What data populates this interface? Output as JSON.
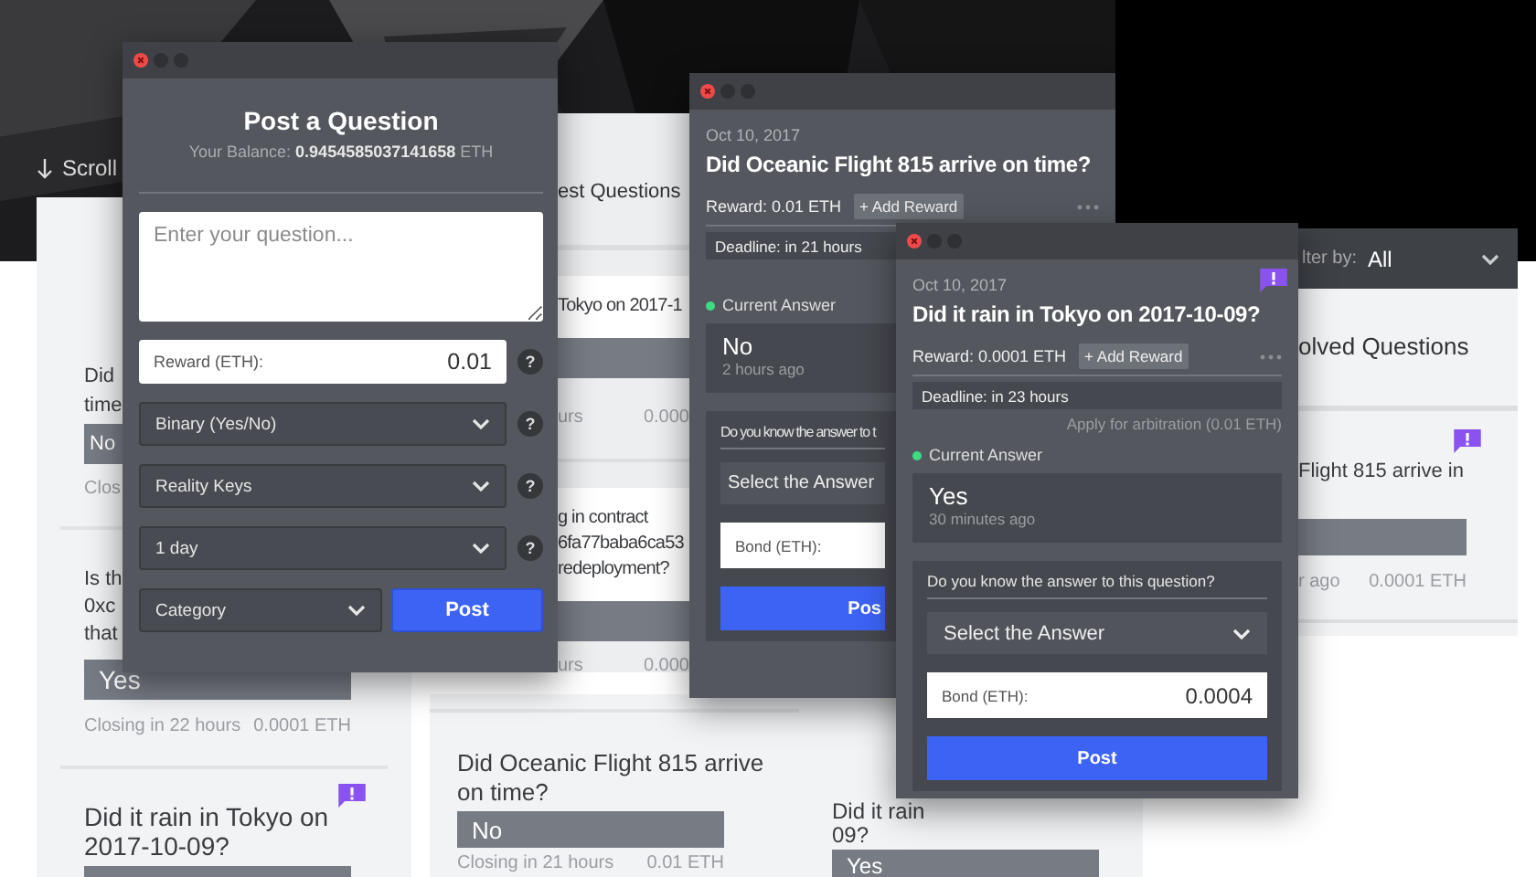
{
  "scroll_hint": "Scroll",
  "left_column": {
    "cards": [
      {
        "question": "Did time",
        "answer": "No",
        "closing": "Clos",
        "flagged": false
      },
      {
        "question": "Is th 0xc that",
        "answer": "Yes",
        "closing": "Closing in 22 hours",
        "reward": "0.0001 ETH",
        "flagged": false
      },
      {
        "question": "Did it rain in Tokyo on 2017-10-09?",
        "flagged": true
      }
    ]
  },
  "middle_column": {
    "heading": "est Questions",
    "cards": [
      {
        "question": "Tokyo on 2017-1",
        "closing": "urs",
        "reward": "0.000",
        "flagged": false
      },
      {
        "question": "g in contract 6fa77baba6ca53 redeployment?",
        "closing": "urs",
        "reward": "0.000",
        "flagged": false
      },
      {
        "question": "Did Oceanic Flight 815 arrive on time?",
        "answer": "No",
        "closing": "Closing in 21 hours",
        "reward": "0.01 ETH",
        "flagged": false
      }
    ]
  },
  "third_column": {
    "cards": [
      {
        "question": "Did it rain 09?",
        "answer": "Yes",
        "flagged": false
      }
    ]
  },
  "right_column": {
    "filter_label": "lter by:",
    "filter_value": "All",
    "heading": "olved Questions",
    "cards": [
      {
        "question": "Flight 815 arrive in",
        "closing": "r ago",
        "reward": "0.0001 ETH",
        "flagged": true
      }
    ]
  },
  "post_window": {
    "title": "Post a Question",
    "balance": "Your Balance: **0.9454585037141658** ETH",
    "question_placeholder": "Enter your question...",
    "reward_label": "Reward (ETH):",
    "reward_value": "0.01",
    "reward_help": "?",
    "selects": [
      {
        "value": "Binary (Yes/No)",
        "help": "?"
      },
      {
        "value": "Reality Keys",
        "help": "?"
      },
      {
        "value": "1 day",
        "help": "?"
      }
    ],
    "category": "Category",
    "post": "Post"
  },
  "question_windows": [
    {
      "date": "Oct 10, 2017",
      "title": "Did Oceanic Flight 815 arrive on time?",
      "reward": "Reward: 0.01 ETH",
      "add_reward": "+ Add Reward",
      "deadline": "Deadline: in 21 hours",
      "current_label": "Current Answer",
      "answer": "No",
      "answer_time": "2 hours ago",
      "prompt": "Do you know the answer to t",
      "select": "Select the Answer",
      "bond_label": "Bond (ETH):",
      "post": "Pos",
      "flagged": false
    },
    {
      "date": "Oct 10, 2017",
      "title": "Did it rain in Tokyo on 2017-10-09?",
      "reward": "Reward: 0.0001 ETH",
      "add_reward": "+ Add Reward",
      "deadline": "Deadline: in 23 hours",
      "arbitration": "Apply for arbitration (0.01 ETH)",
      "current_label": "Current Answer",
      "answer": "Yes",
      "answer_time": "30 minutes ago",
      "prompt": "Do you know the answer to this question?",
      "select": "Select the Answer",
      "bond_label": "Bond (ETH):",
      "bond_value": "0.0004",
      "post": "Post",
      "flagged": true
    }
  ]
}
